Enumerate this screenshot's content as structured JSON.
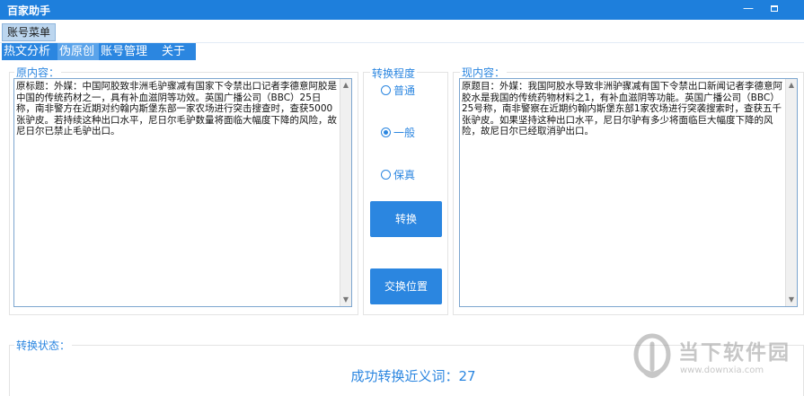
{
  "app": {
    "title": "百家助手"
  },
  "menubar": {
    "root_label": "账号菜单"
  },
  "subnav": {
    "items": [
      {
        "label": "热文分析",
        "active": false
      },
      {
        "label": "伪原创",
        "active": true
      },
      {
        "label": "账号管理",
        "active": false
      },
      {
        "label": "关于",
        "active": false
      }
    ]
  },
  "original": {
    "label": "原内容：",
    "text": "原标题：外媒：中国阿胶致非洲毛驴骤减有国家下令禁出口记者李德意阿胶是中国的传统药材之一，具有补血滋阴等功效。英国广播公司（BBC）25日称，南非警方在近期对约翰内斯堡东部一家农场进行突击搜查时，查获5000张驴皮。若持续这种出口水平，尼日尔毛驴数量将面临大幅度下降的风险，故尼日尔已禁止毛驴出口。"
  },
  "degree": {
    "label": "转换程度",
    "options": [
      {
        "label": "普通",
        "selected": false
      },
      {
        "label": "一般",
        "selected": true
      },
      {
        "label": "保真",
        "selected": false
      }
    ]
  },
  "buttons": {
    "convert": "转换",
    "swap": "交换位置"
  },
  "result": {
    "label": "现内容：",
    "text": "原题目：外媒：我国阿胶水导致非洲驴骤减有国下令禁出口新闻记者李德意阿胶水是我国的传统药物材料之1，有补血滋阴等功能。英国广播公司（BBC）25号称，南非警察在近期约翰内斯堡东部1家农场进行突袭搜索时，查获五千张驴皮。如果坚持这种出口水平，尼日尔驴有多少将面临巨大幅度下降的风险，故尼日尔已经取消驴出口。"
  },
  "status": {
    "label": "转换状态：",
    "message": "成功转换近义词：27"
  },
  "watermark": {
    "text": "当下软件园",
    "url": "www.downxia.com"
  }
}
